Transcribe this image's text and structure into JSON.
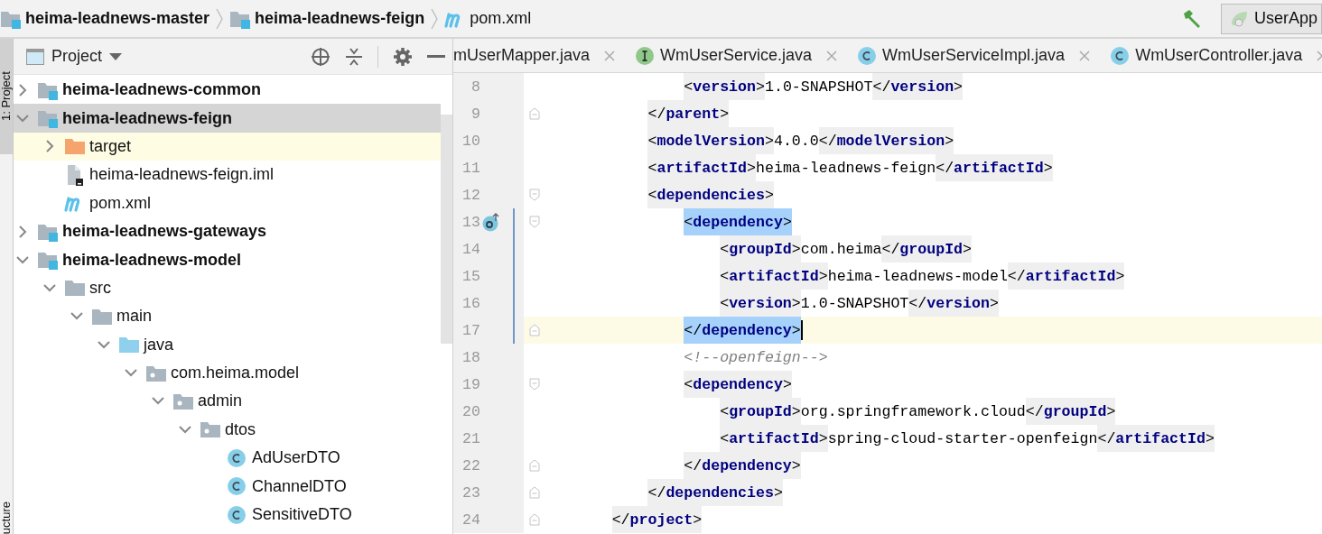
{
  "breadcrumbs": [
    {
      "kind": "module",
      "label": "heima-leadnews-master"
    },
    {
      "kind": "module",
      "label": "heima-leadnews-feign"
    },
    {
      "kind": "maven",
      "label": "pom.xml"
    }
  ],
  "toolbar": {
    "run_config": "UserApp"
  },
  "side_strip": {
    "top_label": "1: Project",
    "bottom_label": "ucture"
  },
  "project_panel": {
    "title": "Project",
    "tree": [
      {
        "kind": "module",
        "label": "heima-leadnews-common",
        "expanded": false,
        "selected": false,
        "highlighted": false
      },
      {
        "kind": "module",
        "label": "heima-leadnews-feign",
        "expanded": true,
        "selected": true,
        "highlighted": false,
        "children": [
          {
            "kind": "excluded-folder",
            "label": "target",
            "expanded": false,
            "selected": false,
            "highlighted": true
          },
          {
            "kind": "iml",
            "label": "heima-leadnews-feign.iml",
            "selected": false,
            "highlighted": false
          },
          {
            "kind": "maven",
            "label": "pom.xml",
            "selected": false,
            "highlighted": false
          }
        ]
      },
      {
        "kind": "module",
        "label": "heima-leadnews-gateways",
        "expanded": false,
        "selected": false,
        "highlighted": false
      },
      {
        "kind": "module",
        "label": "heima-leadnews-model",
        "expanded": true,
        "selected": false,
        "highlighted": false,
        "children": [
          {
            "kind": "folder",
            "label": "src",
            "expanded": true,
            "selected": false,
            "highlighted": false,
            "children": [
              {
                "kind": "folder",
                "label": "main",
                "expanded": true,
                "selected": false,
                "highlighted": false,
                "children": [
                  {
                    "kind": "source-folder",
                    "label": "java",
                    "expanded": true,
                    "selected": false,
                    "highlighted": false,
                    "children": [
                      {
                        "kind": "package",
                        "label": "com.heima.model",
                        "expanded": true,
                        "selected": false,
                        "highlighted": false,
                        "children": [
                          {
                            "kind": "package",
                            "label": "admin",
                            "expanded": true,
                            "selected": false,
                            "highlighted": false,
                            "children": [
                              {
                                "kind": "package",
                                "label": "dtos",
                                "expanded": true,
                                "selected": false,
                                "highlighted": false,
                                "children": [
                                  {
                                    "kind": "class",
                                    "label": "AdUserDTO",
                                    "selected": false,
                                    "highlighted": false
                                  },
                                  {
                                    "kind": "class",
                                    "label": "ChannelDTO",
                                    "selected": false,
                                    "highlighted": false
                                  },
                                  {
                                    "kind": "class",
                                    "label": "SensitiveDTO",
                                    "selected": false,
                                    "highlighted": false
                                  }
                                ]
                              }
                            ]
                          }
                        ]
                      }
                    ]
                  }
                ]
              }
            ]
          }
        ]
      }
    ]
  },
  "editor": {
    "tabs": [
      {
        "label": "mUserMapper.java",
        "kind": "plain"
      },
      {
        "label": "WmUserService.java",
        "kind": "interface"
      },
      {
        "label": "WmUserServiceImpl.java",
        "kind": "class"
      },
      {
        "label": "WmUserController.java",
        "kind": "class"
      }
    ],
    "lines": [
      {
        "number": "8",
        "current": false,
        "changed": false,
        "fold_start": false,
        "fold_end": false,
        "implemented": false,
        "tokens": [
          {
            "kind": "tag",
            "text": "<version>",
            "matched": false
          },
          {
            "kind": "text",
            "text": "1.0-SNAPSHOT"
          },
          {
            "kind": "tag",
            "text": "</version>",
            "matched": false
          }
        ]
      },
      {
        "number": "9",
        "current": false,
        "changed": false,
        "fold_start": false,
        "fold_end": true,
        "implemented": false,
        "tokens": [
          {
            "kind": "tag",
            "text": "</parent>",
            "matched": false
          }
        ]
      },
      {
        "number": "10",
        "current": false,
        "changed": false,
        "fold_start": false,
        "fold_end": false,
        "implemented": false,
        "tokens": [
          {
            "kind": "tag",
            "text": "<modelVersion>",
            "matched": false
          },
          {
            "kind": "text",
            "text": "4.0.0"
          },
          {
            "kind": "tag",
            "text": "</modelVersion>",
            "matched": false
          }
        ]
      },
      {
        "number": "11",
        "current": false,
        "changed": false,
        "fold_start": false,
        "fold_end": false,
        "implemented": false,
        "tokens": [
          {
            "kind": "tag",
            "text": "<artifactId>",
            "matched": false
          },
          {
            "kind": "text",
            "text": "heima-leadnews-feign"
          },
          {
            "kind": "tag",
            "text": "</artifactId>",
            "matched": false
          }
        ]
      },
      {
        "number": "12",
        "current": false,
        "changed": false,
        "fold_start": true,
        "fold_end": false,
        "implemented": false,
        "tokens": [
          {
            "kind": "tag",
            "text": "<dependencies>",
            "matched": false
          }
        ]
      },
      {
        "number": "13",
        "current": false,
        "changed": true,
        "fold_start": true,
        "fold_end": false,
        "implemented": true,
        "tokens": [
          {
            "kind": "tag",
            "text": "<dependency>",
            "matched": true
          }
        ]
      },
      {
        "number": "14",
        "current": false,
        "changed": true,
        "fold_start": false,
        "fold_end": false,
        "implemented": false,
        "tokens": [
          {
            "kind": "tag",
            "text": "<groupId>",
            "matched": false
          },
          {
            "kind": "text",
            "text": "com.heima"
          },
          {
            "kind": "tag",
            "text": "</groupId>",
            "matched": false
          }
        ]
      },
      {
        "number": "15",
        "current": false,
        "changed": true,
        "fold_start": false,
        "fold_end": false,
        "implemented": false,
        "tokens": [
          {
            "kind": "tag",
            "text": "<artifactId>",
            "matched": false
          },
          {
            "kind": "text",
            "text": "heima-leadnews-model"
          },
          {
            "kind": "tag",
            "text": "</artifactId>",
            "matched": false
          }
        ]
      },
      {
        "number": "16",
        "current": false,
        "changed": true,
        "fold_start": false,
        "fold_end": false,
        "implemented": false,
        "tokens": [
          {
            "kind": "tag",
            "text": "<version>",
            "matched": false
          },
          {
            "kind": "text",
            "text": "1.0-SNAPSHOT"
          },
          {
            "kind": "tag",
            "text": "</version>",
            "matched": false
          }
        ]
      },
      {
        "number": "17",
        "current": true,
        "changed": true,
        "fold_start": false,
        "fold_end": true,
        "implemented": false,
        "tokens": [
          {
            "kind": "tag",
            "text": "</dependency>",
            "matched": true
          }
        ]
      },
      {
        "number": "18",
        "current": false,
        "changed": false,
        "fold_start": false,
        "fold_end": false,
        "implemented": false,
        "tokens": [
          {
            "kind": "comment",
            "text": "<!--openfeign-->"
          }
        ]
      },
      {
        "number": "19",
        "current": false,
        "changed": false,
        "fold_start": true,
        "fold_end": false,
        "implemented": false,
        "tokens": [
          {
            "kind": "tag",
            "text": "<dependency>",
            "matched": false
          }
        ]
      },
      {
        "number": "20",
        "current": false,
        "changed": false,
        "fold_start": false,
        "fold_end": false,
        "implemented": false,
        "tokens": [
          {
            "kind": "tag",
            "text": "<groupId>",
            "matched": false
          },
          {
            "kind": "text",
            "text": "org.springframework.cloud"
          },
          {
            "kind": "tag",
            "text": "</groupId>",
            "matched": false
          }
        ]
      },
      {
        "number": "21",
        "current": false,
        "changed": false,
        "fold_start": false,
        "fold_end": false,
        "implemented": false,
        "tokens": [
          {
            "kind": "tag",
            "text": "<artifactId>",
            "matched": false
          },
          {
            "kind": "text",
            "text": "spring-cloud-starter-openfeign"
          },
          {
            "kind": "tag",
            "text": "</artifactId>",
            "matched": false
          }
        ]
      },
      {
        "number": "22",
        "current": false,
        "changed": false,
        "fold_start": false,
        "fold_end": true,
        "implemented": false,
        "tokens": [
          {
            "kind": "tag",
            "text": "</dependency>",
            "matched": false
          }
        ]
      },
      {
        "number": "23",
        "current": false,
        "changed": false,
        "fold_start": false,
        "fold_end": true,
        "implemented": false,
        "tokens": [
          {
            "kind": "tag",
            "text": "</dependencies>",
            "matched": false
          }
        ]
      },
      {
        "number": "24",
        "current": false,
        "changed": false,
        "fold_start": false,
        "fold_end": true,
        "implemented": false,
        "tokens": [
          {
            "kind": "tag",
            "text": "</project>",
            "matched": false
          }
        ]
      }
    ]
  }
}
